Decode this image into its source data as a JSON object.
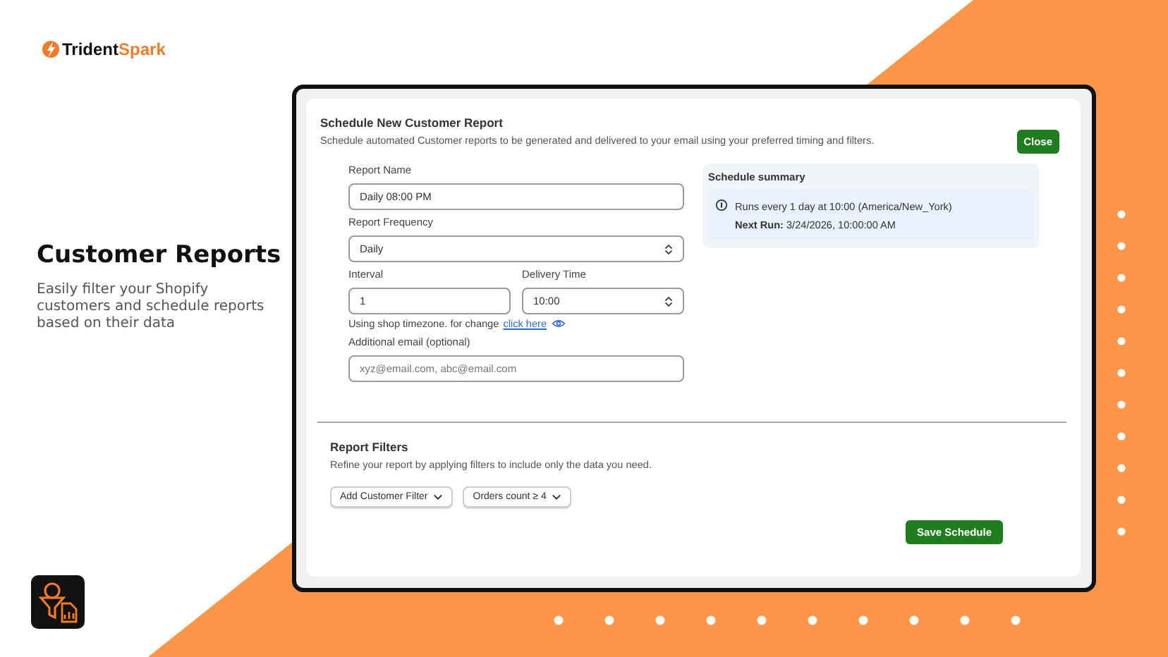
{
  "logo": {
    "first": "Trident",
    "second": "Spark"
  },
  "hero": {
    "title": "Customer Reports",
    "subtitle": "Easily filter your Shopify customers and schedule reports based on their data"
  },
  "dialog": {
    "title": "Schedule New Customer Report",
    "description": "Schedule automated Customer reports to be generated and delivered to your email using your preferred timing and filters.",
    "close": "Close",
    "report_name": {
      "label": "Report Name",
      "value": "Daily 08:00 PM"
    },
    "frequency": {
      "label": "Report Frequency",
      "value": "Daily"
    },
    "interval": {
      "label": "Interval",
      "value": "1"
    },
    "delivery_time": {
      "label": "Delivery Time",
      "value": "10:00"
    },
    "timezone_note": {
      "text": "Using shop timezone. for change",
      "link": "click here"
    },
    "email": {
      "label": "Additional email (optional)",
      "placeholder": "xyz@email.com, abc@email.com"
    },
    "summary": {
      "title": "Schedule summary",
      "line": "Runs every 1 day at 10:00 (America/New_York)",
      "next_run": "**Next Run:** 3/24/2026, 10:00:00 AM"
    },
    "filters": {
      "title": "Report Filters",
      "description": "Refine your report by applying filters to include only the data you need.",
      "buttons": [
        "Add Customer Filter",
        "Orders count ≥ 4"
      ]
    },
    "save": "Save Schedule"
  }
}
